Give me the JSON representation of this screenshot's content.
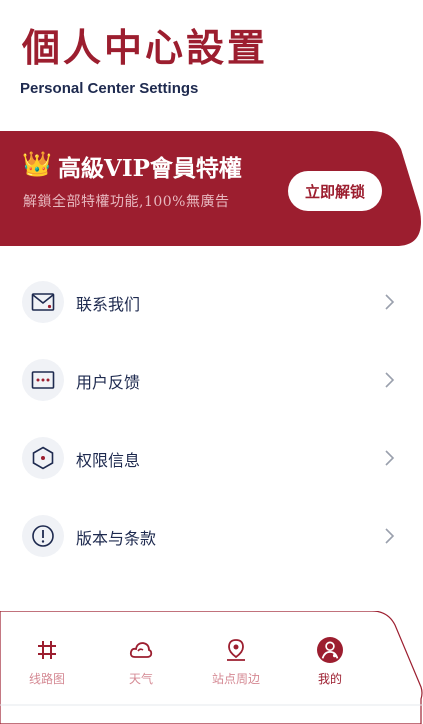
{
  "header": {
    "title": "個人中心設置",
    "subtitle": "Personal Center Settings"
  },
  "vip": {
    "icon": "crown-icon",
    "title": "高級VIP會員特權",
    "description": "解鎖全部特權功能,100%無廣告",
    "button_label": "立即解锁"
  },
  "menu": {
    "items": [
      {
        "label": "联系我们",
        "icon": "envelope-icon"
      },
      {
        "label": "用户反馈",
        "icon": "chat-icon"
      },
      {
        "label": "权限信息",
        "icon": "hexagon-icon"
      },
      {
        "label": "版本与条款",
        "icon": "info-icon"
      }
    ]
  },
  "bottom_nav": {
    "items": [
      {
        "label": "线路图",
        "icon": "route-map-icon",
        "active": false
      },
      {
        "label": "天气",
        "icon": "cloud-icon",
        "active": false
      },
      {
        "label": "站点周边",
        "icon": "location-pin-icon",
        "active": false
      },
      {
        "label": "我的",
        "icon": "profile-icon",
        "active": true
      }
    ]
  },
  "colors": {
    "accent": "#9c1e2f",
    "nav_inactive": "#d58a94",
    "text_dark": "#1e2a4f",
    "icon_bg": "#f0f2f6"
  }
}
